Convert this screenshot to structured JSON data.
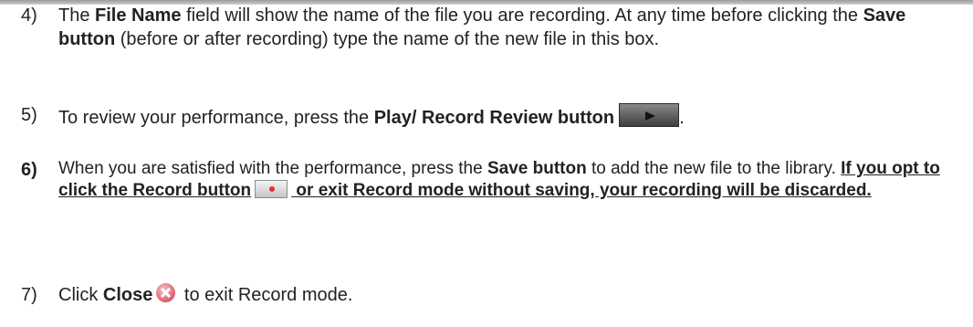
{
  "steps": {
    "s4": {
      "num": "4)",
      "p1": "The ",
      "b1": "File Name",
      "p2": " field will show the name of the file you are recording. At any time before clicking the ",
      "b2": "Save button",
      "p3": " (before or after recording) type the name of the new file in this box."
    },
    "s5": {
      "num": "5)",
      "p1": "To review your performance, press the ",
      "b1": "Play/ Record Review button",
      "p2": ".",
      "icon": "play-button-icon"
    },
    "s6": {
      "num": "6)",
      "p1": "When you are satisfied with the performance, press the ",
      "b1": "Save button",
      "p2": " to add the new file to the library. ",
      "u1": "If you opt to click the Record button",
      "u2": " or exit Record mode without saving, your recording will be discarded.",
      "icon": "record-button-icon"
    },
    "s7": {
      "num": "7)",
      "p1": "Click ",
      "b1": "Close",
      "p2": " to exit Record mode.",
      "icon": "close-icon"
    }
  }
}
